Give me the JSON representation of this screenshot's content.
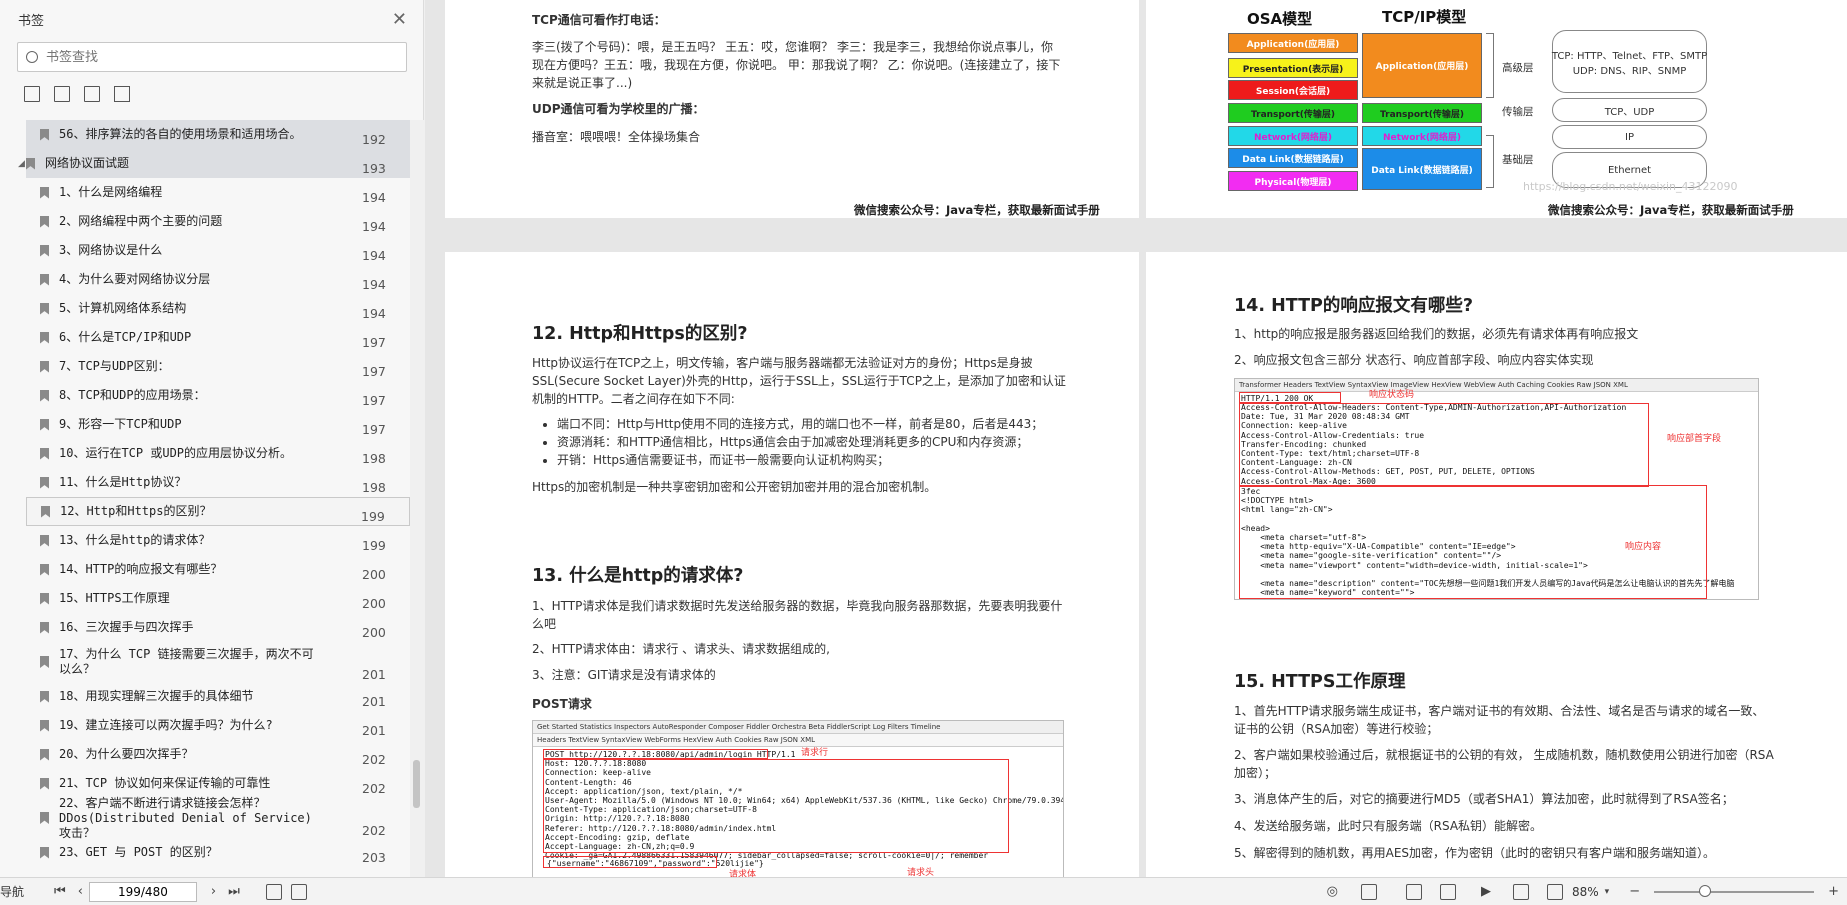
{
  "sidebar": {
    "title": "书签",
    "search_placeholder": "书签查找",
    "outline": [
      {
        "text": "56、排序算法的各自的使用场景和适用场合。",
        "page": "192",
        "state": "selected",
        "level": 1,
        "multiline": false
      },
      {
        "text": "网络协议面试题",
        "page": "193",
        "state": "selected",
        "level": 0,
        "multiline": false
      },
      {
        "text": "1、什么是网络编程",
        "page": "194",
        "level": 1
      },
      {
        "text": "2、网络编程中两个主要的问题",
        "page": "194",
        "level": 1
      },
      {
        "text": "3、网络协议是什么",
        "page": "194",
        "level": 1
      },
      {
        "text": "4、为什么要对网络协议分层",
        "page": "194",
        "level": 1
      },
      {
        "text": "5、计算机网络体系结构",
        "page": "194",
        "level": 1
      },
      {
        "text": "6、什么是TCP/IP和UDP",
        "page": "197",
        "level": 1
      },
      {
        "text": "7、TCP与UDP区别：",
        "page": "197",
        "level": 1
      },
      {
        "text": "8、TCP和UDP的应用场景：",
        "page": "197",
        "level": 1
      },
      {
        "text": "9、形容一下TCP和UDP",
        "page": "197",
        "level": 1
      },
      {
        "text": "10、运行在TCP 或UDP的应用层协议分析。",
        "page": "198",
        "level": 1
      },
      {
        "text": "11、什么是Http协议？",
        "page": "198",
        "level": 1
      },
      {
        "text": "12、Http和Https的区别？",
        "page": "199",
        "level": 1,
        "state": "current"
      },
      {
        "text": "13、什么是http的请求体？",
        "page": "199",
        "level": 1
      },
      {
        "text": "14、HTTP的响应报文有哪些？",
        "page": "200",
        "level": 1
      },
      {
        "text": "15、HTTPS工作原理",
        "page": "200",
        "level": 1
      },
      {
        "text": "16、三次握手与四次挥手",
        "page": "200",
        "level": 1
      },
      {
        "text": "17、为什么 TCP 链接需要三次握手，两次不可以么？",
        "page": "201",
        "level": 1,
        "multiline": true
      },
      {
        "text": "18、用现实理解三次握手的具体细节",
        "page": "201",
        "level": 1
      },
      {
        "text": "19、建立连接可以两次握手吗？为什么?",
        "page": "201",
        "level": 1
      },
      {
        "text": "20、为什么要四次挥手？",
        "page": "202",
        "level": 1
      },
      {
        "text": "21、TCP 协议如何来保证传输的可靠性",
        "page": "202",
        "level": 1
      },
      {
        "text": "22、客户端不断进行请求链接会怎样？DDos(Distributed Denial of Service)攻击？",
        "page": "202",
        "level": 1,
        "multiline": true
      },
      {
        "text": "23、GET 与 POST 的区别？",
        "page": "203",
        "level": 1
      }
    ]
  },
  "top_left_page": {
    "h1": "TCP通信可看作打电话：",
    "p1": "李三(拨了个号码)：喂，是王五吗？ 王五：哎，您谁啊？ 李三：我是李三，我想给你说点事儿，你现在方便吗？王五：哦，我现在方便，你说吧。 甲：那我说了啊？ 乙：你说吧。(连接建立了，接下来就是说正事了...)",
    "h2": "UDP通信可看为学校里的广播：",
    "p2": "播音室：喂喂喂！全体操场集合",
    "footer": "微信搜索公众号：Java专栏，获取最新面试手册"
  },
  "top_right_page": {
    "osa_title": "OSA模型",
    "tcpip_title": "TCP/IP模型",
    "osa_layers": [
      {
        "label": "Application(应用层)",
        "color": "#f28b1e"
      },
      {
        "label": "Presentation(表示层)",
        "color": "#f7f21a"
      },
      {
        "label": "Session(会话层)",
        "color": "#ee1b1b"
      },
      {
        "label": "Transport(传输层)",
        "color": "#1fcc1f"
      },
      {
        "label": "Network(网络层)",
        "color": "#22d8e8"
      },
      {
        "label": "Data Link(数据链路层)",
        "color": "#1c8ce8"
      },
      {
        "label": "Physical(物理层)",
        "color": "#f22cf2"
      }
    ],
    "tcpip_layers": [
      {
        "label": "Application(应用层)",
        "color": "#f28b1e"
      },
      {
        "label": "Transport(传输层)",
        "color": "#1fcc1f"
      },
      {
        "label": "Network(网络层)",
        "color": "#22d8e8"
      },
      {
        "label": "Data Link(数据链路层)",
        "color": "#1c8ce8"
      }
    ],
    "side_labels": {
      "high": "高级层",
      "transport": "传输层",
      "base": "基础层"
    },
    "protocols": {
      "app": "TCP: HTTP、Telnet、FTP、SMTP\nUDP: DNS、RIP、SNMP",
      "transport": "TCP、UDP",
      "network": "IP",
      "link": "Ethernet"
    },
    "watermark": "https://blog.csdn.net/weixin_43122090",
    "footer": "微信搜索公众号：Java专栏，获取最新面试手册"
  },
  "left_page": {
    "h12": "12. Http和Https的区别?",
    "p12": "Http协议运行在TCP之上，明文传输，客户端与服务器端都无法验证对方的身份；Https是身披SSL(Secure Socket Layer)外壳的Http，运行于SSL上，SSL运行于TCP之上，是添加了加密和认证机制的HTTP。二者之间存在如下不同:",
    "bullets12": [
      "端口不同：Http与Http使用不同的连接方式，用的端口也不一样，前者是80，后者是443；",
      "资源消耗：和HTTP通信相比，Https通信会由于加减密处理消耗更多的CPU和内存资源；",
      "开销：Https通信需要证书，而证书一般需要向认证机构购买；"
    ],
    "p12b": "Https的加密机制是一种共享密钥加密和公开密钥加密并用的混合加密机制。",
    "h13": "13. 什么是http的请求体?",
    "p13_1": "1、HTTP请求体是我们请求数据时先发送给服务器的数据，毕竟我向服务器那数据，先要表明我要什么吧",
    "p13_2": "2、HTTP请求体由：请求行 、请求头、请求数据组成的,",
    "p13_3": "3、注意：GIT请求是没有请求体的",
    "post_label": "POST请求",
    "fiddler_tabs": "Get Started   Statistics   Inspectors   AutoResponder   Composer   Fiddler Orchestra Beta   FiddlerScript   Log   Filters   Timeline",
    "fiddler_subtabs": "Headers   TextView   SyntaxView   WebForms   HexView   Auth   Cookies   Raw   JSON   XML",
    "request_lines": "POST http://120.?.?.18:8080/api/admin/login HTTP/1.1\nHost: 120.?.?.18:8080\nConnection: keep-alive\nContent-Length: 46\nAccept: application/json, text/plain, */*\nUser-Agent: Mozilla/5.0 (Windows NT 10.0; Win64; x64) AppleWebKit/537.36 (KHTML, like Gecko) Chrome/79.0.3945.130 Safari/537.36\nContent-Type: application/json;charset=UTF-8\nOrigin: http://120.?.?.18:8080\nReferer: http://120.?.?.18:8080/admin/index.html\nAccept-Encoding: gzip, deflate\nAccept-Language: zh-CN,zh;q=0.9\nCookie: _ga=GA1.2.498866331.1583946077; sidebar_collapsed=false; scroll-cookie=0|/; remember",
    "request_body": "{\"username\":\"46867109\",\"password\":\"520lijie\"}",
    "lbl_line": "请求行",
    "lbl_head": "请求头",
    "lbl_body": "请求体"
  },
  "right_page": {
    "h14": "14. HTTP的响应报文有哪些?",
    "p14_1": "1、http的响应报是服务器返回给我们的数据，必须先有请求体再有响应报文",
    "p14_2": "2、响应报文包含三部分 状态行、响应首部字段、响应内容实体实现",
    "resp_tabs": "Transformer   Headers   TextView   SyntaxView   ImageView   HexView   WebView   Auth   Caching   Cookies   Raw   JSON   XML",
    "status_line": "HTTP/1.1 200 OK",
    "resp_headers": "Access-Control-Allow-Headers: Content-Type,ADMIN-Authorization,API-Authorization\nDate: Tue, 31 Mar 2020 08:48:34 GMT\nConnection: keep-alive\nAccess-Control-Allow-Credentials: true\nTransfer-Encoding: chunked\nContent-Type: text/html;charset=UTF-8\nContent-Language: zh-CN\nAccess-Control-Allow-Methods: GET, POST, PUT, DELETE, OPTIONS\nAccess-Control-Max-Age: 3600",
    "resp_body": "3fec\n<!DOCTYPE html>\n<html lang=\"zh-CN\">\n\n<head>\n    <meta charset=\"utf-8\">\n    <meta http-equiv=\"X-UA-Compatible\" content=\"IE=edge\">\n    <meta name=\"google-site-verification\" content=\"\"/>\n    <meta name=\"viewport\" content=\"width=device-width, initial-scale=1\">\n\n    <meta name=\"description\" content=\"TOC先想想一些问题1我们开发人员编写的Java代码是怎么让电脑认识的首先先了解电脑\n    <meta name=\"keyword\" content=\"\">\n    <meta name=\"generator\" content=\"Halo 1.3.0\"/>",
    "lbl_status": "响应状态码",
    "lbl_headers": "响应部首字段",
    "lbl_body": "响应内容",
    "h15": "15. HTTPS工作原理",
    "p15": [
      "1、首先HTTP请求服务端生成证书，客户端对证书的有效期、合法性、域名是否与请求的域名一致、证书的公钥（RSA加密）等进行校验；",
      "2、客户端如果校验通过后，就根据证书的公钥的有效， 生成随机数，随机数使用公钥进行加密（RSA加密）；",
      "3、消息体产生的后，对它的摘要进行MD5（或者SHA1）算法加密，此时就得到了RSA签名；",
      "4、发送给服务端，此时只有服务端（RSA私钥）能解密。",
      "5、解密得到的随机数，再用AES加密，作为密钥（此时的密钥只有客户端和服务端知道）。"
    ]
  },
  "bottombar": {
    "nav_label": "导航",
    "page_value": "199/480",
    "zoom": "88%",
    "zoom_level": 0.32
  }
}
